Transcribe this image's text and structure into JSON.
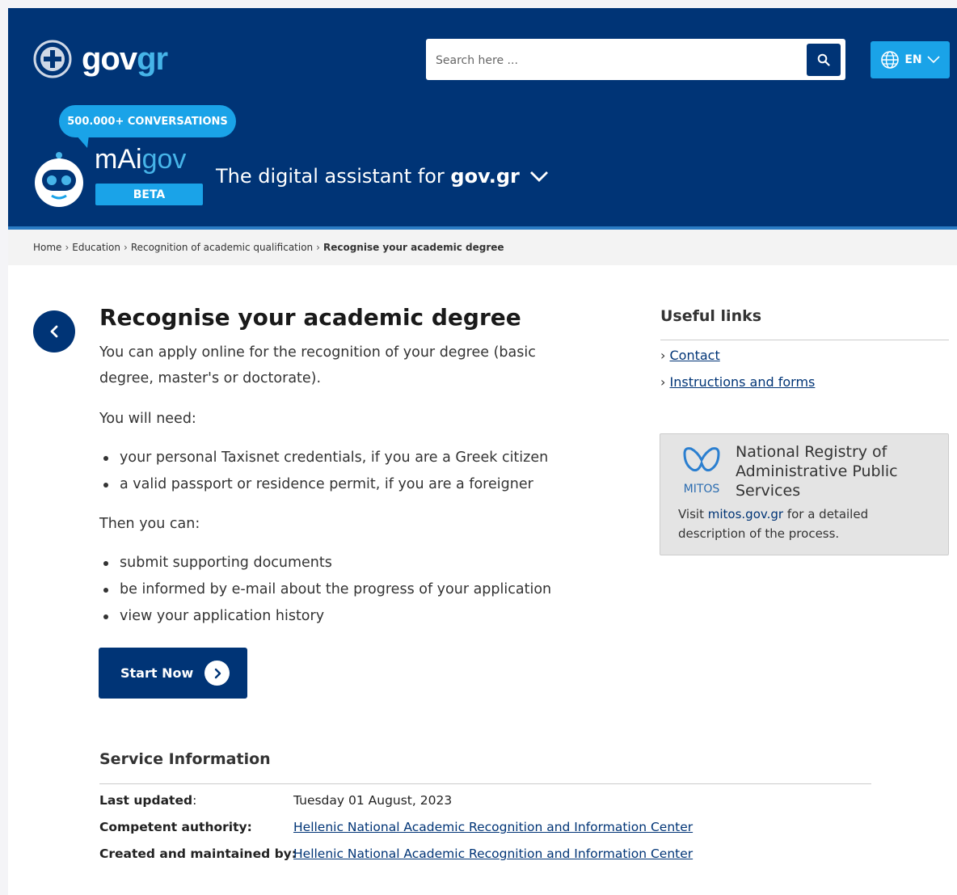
{
  "header": {
    "logo": {
      "main": "gov",
      "accent": "gr"
    },
    "search": {
      "placeholder": "Search here ..."
    },
    "language": {
      "label": "EN"
    },
    "chat": {
      "bubble": "500.000+ CONVERSATIONS",
      "brand_main": "mAi",
      "brand_accent": "gov",
      "badge": "BETA",
      "tagline_prefix": "The digital assistant for",
      "tagline_bold": "gov.gr"
    }
  },
  "breadcrumb": {
    "items": [
      "Home",
      "Education",
      "Recognition of academic qualification"
    ],
    "current": "Recognise your academic degree",
    "separator": "›"
  },
  "main": {
    "title": "Recognise your academic degree",
    "intro": "You can apply online for the recognition of your degree (basic degree, master's or doctorate).",
    "need_heading": "You will need:",
    "need_items": [
      "your personal Taxisnet credentials, if you are a Greek citizen",
      "a valid passport or residence permit, if you are a foreigner"
    ],
    "then_heading": "Then you can:",
    "then_items": [
      "submit supporting documents",
      "be informed by e-mail about the progress of your application",
      "view your application history"
    ],
    "start_button": "Start Now"
  },
  "sidebar": {
    "title": "Useful links",
    "bullet": "›",
    "links": [
      "Contact",
      "Instructions and forms"
    ],
    "mitos": {
      "logo_text": "MITOS",
      "name": "National Registry of Administrative Public Services",
      "desc_prefix": "Visit",
      "link": "mitos.gov.gr",
      "desc_suffix": "for a detailed description of the process."
    }
  },
  "service_info": {
    "title": "Service Information",
    "rows": [
      {
        "label": "Last updated",
        "colon": ":",
        "value": "Tuesday 01 August, 2023"
      },
      {
        "label": "Competent authority:",
        "colon": "",
        "value": "Hellenic National Academic Recognition and Information Center"
      },
      {
        "label": "Created and maintained by:",
        "colon": "",
        "value": "Hellenic National Academic Recognition and Information Center"
      }
    ]
  },
  "colors": {
    "header_bg": "#003476",
    "accent_blue": "#1aa3e8",
    "logo_accent": "#46b4e8",
    "panel_gray": "#e4e4e4"
  },
  "icons": [
    "greek-emblem-icon",
    "search-icon",
    "globe-icon",
    "chevron-down-icon",
    "robot-icon",
    "chevron-left-icon",
    "chevron-right-icon",
    "mitos-logo-icon"
  ]
}
